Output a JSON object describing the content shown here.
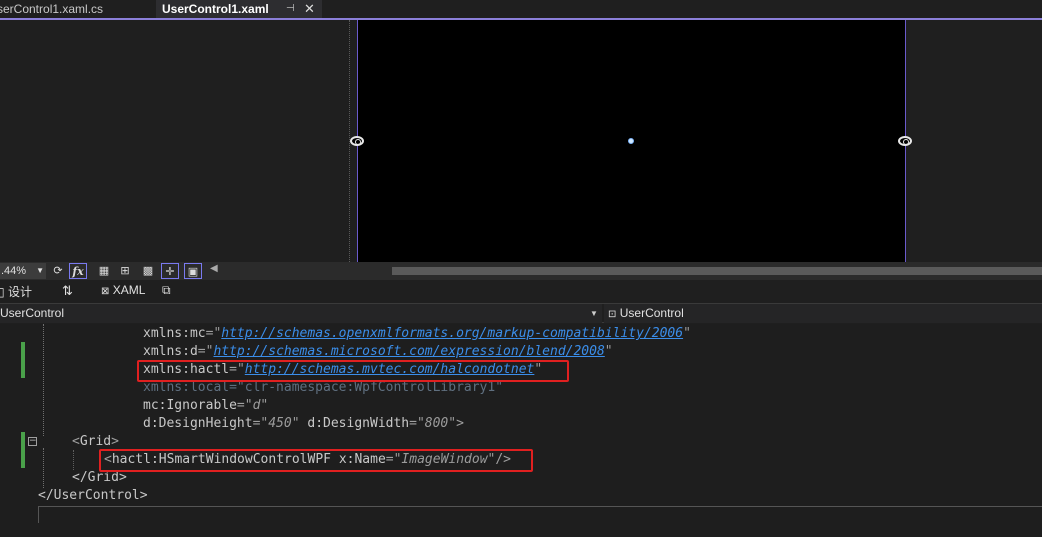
{
  "tabs": [
    {
      "label": "serControl1.xaml.cs",
      "active": false
    },
    {
      "label": "UserControl1.xaml",
      "active": true,
      "pin_icon": "pin-icon",
      "close_icon": "close-icon"
    }
  ],
  "tab_symbols": {
    "pin": "⊣",
    "close": "✕"
  },
  "zoom_toolbar": {
    "zoom_value": ".44%",
    "icons": [
      "refresh-icon",
      "fx-icon",
      "grid-icon",
      "snap-grid-icon",
      "checker-icon",
      "snap-lines-icon",
      "device-icon"
    ],
    "fx_label": "fx"
  },
  "view_bar": {
    "design_label": "设计",
    "swap_symbol": "⇅",
    "xaml_label": "XAML",
    "popout_icon": "popout-icon"
  },
  "nav": {
    "left_combo": "UserControl",
    "right_combo": "UserControl"
  },
  "code": {
    "l1_prefix": "xmlns",
    "l1_ns": "mc",
    "l1_url": "http://schemas.openxmlformats.org/markup-compatibility/2006",
    "l2_prefix": "xmlns",
    "l2_ns": "d",
    "l2_url": "http://schemas.microsoft.com/expression/blend/2008",
    "l3_prefix": "xmlns",
    "l3_ns": "hactl",
    "l3_url": "http://schemas.mvtec.com/halcondotnet",
    "l4_text": "xmlns:local=\"clr-namespace:WpfControlLibrary1\"",
    "l5_attr": "mc:Ignorable",
    "l5_val": "\"d\"",
    "l6_attr1": "d:DesignHeight",
    "l6_val1": "\"450\"",
    "l6_attr2": "d:DesignWidth",
    "l6_val2": "\"800\"",
    "l6_end": ">",
    "l7_open": "<",
    "l7_tag": "Grid",
    "l7_close": ">",
    "l8_open": "<",
    "l8_tag": "hactl:HSmartWindowControlWPF",
    "l8_attr": "x:Name",
    "l8_val": "\"ImageWindow\"",
    "l8_close": "/>",
    "l9_text": "</Grid>",
    "l10_text": "</UserControl>"
  },
  "colors": {
    "accent_tab": "#8b7fd9",
    "highlight_box": "#e02020",
    "change_bar": "#4aa14a"
  }
}
